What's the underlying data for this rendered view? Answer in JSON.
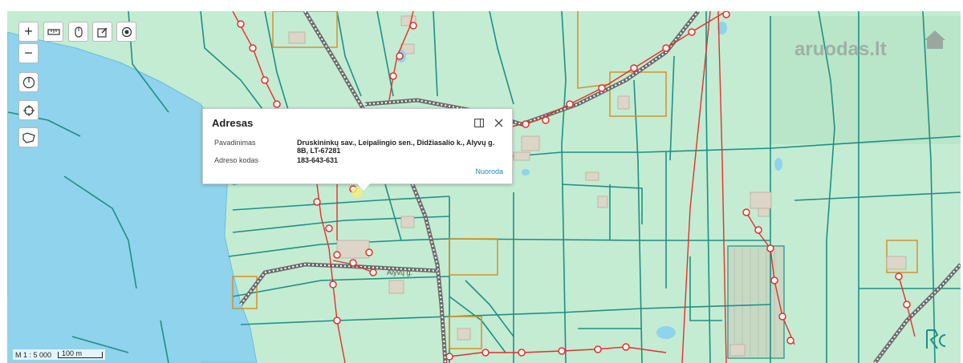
{
  "toolbar": {
    "zoom_in": "+",
    "zoom_out": "−",
    "icons": [
      "measure-icon",
      "mouse-icon",
      "edit-icon",
      "target-icon",
      "power-icon",
      "locate-icon",
      "shape-icon"
    ]
  },
  "popup": {
    "title": "Adresas",
    "rows": [
      {
        "label": "Pavadinimas",
        "value": "Druskininkų sav., Leipalingio sen., Didžiasalio k., Alyvų g. 8B, LT-67281"
      },
      {
        "label": "Adreso kodas",
        "value": "183-643-631"
      }
    ],
    "link": "Nuoroda"
  },
  "scale": {
    "ratio": "M 1 : 5 000",
    "bar_label": "100 m"
  },
  "watermark": "aruodas.lt",
  "map_labels": {
    "street": "Alyvų g."
  },
  "colors": {
    "land": "#c4ecd2",
    "water": "#8fd3ec",
    "parcel": "#1e8f86",
    "road": "#8a8a8a",
    "power_line": "#e3302b",
    "building_outline": "#d8902a"
  }
}
